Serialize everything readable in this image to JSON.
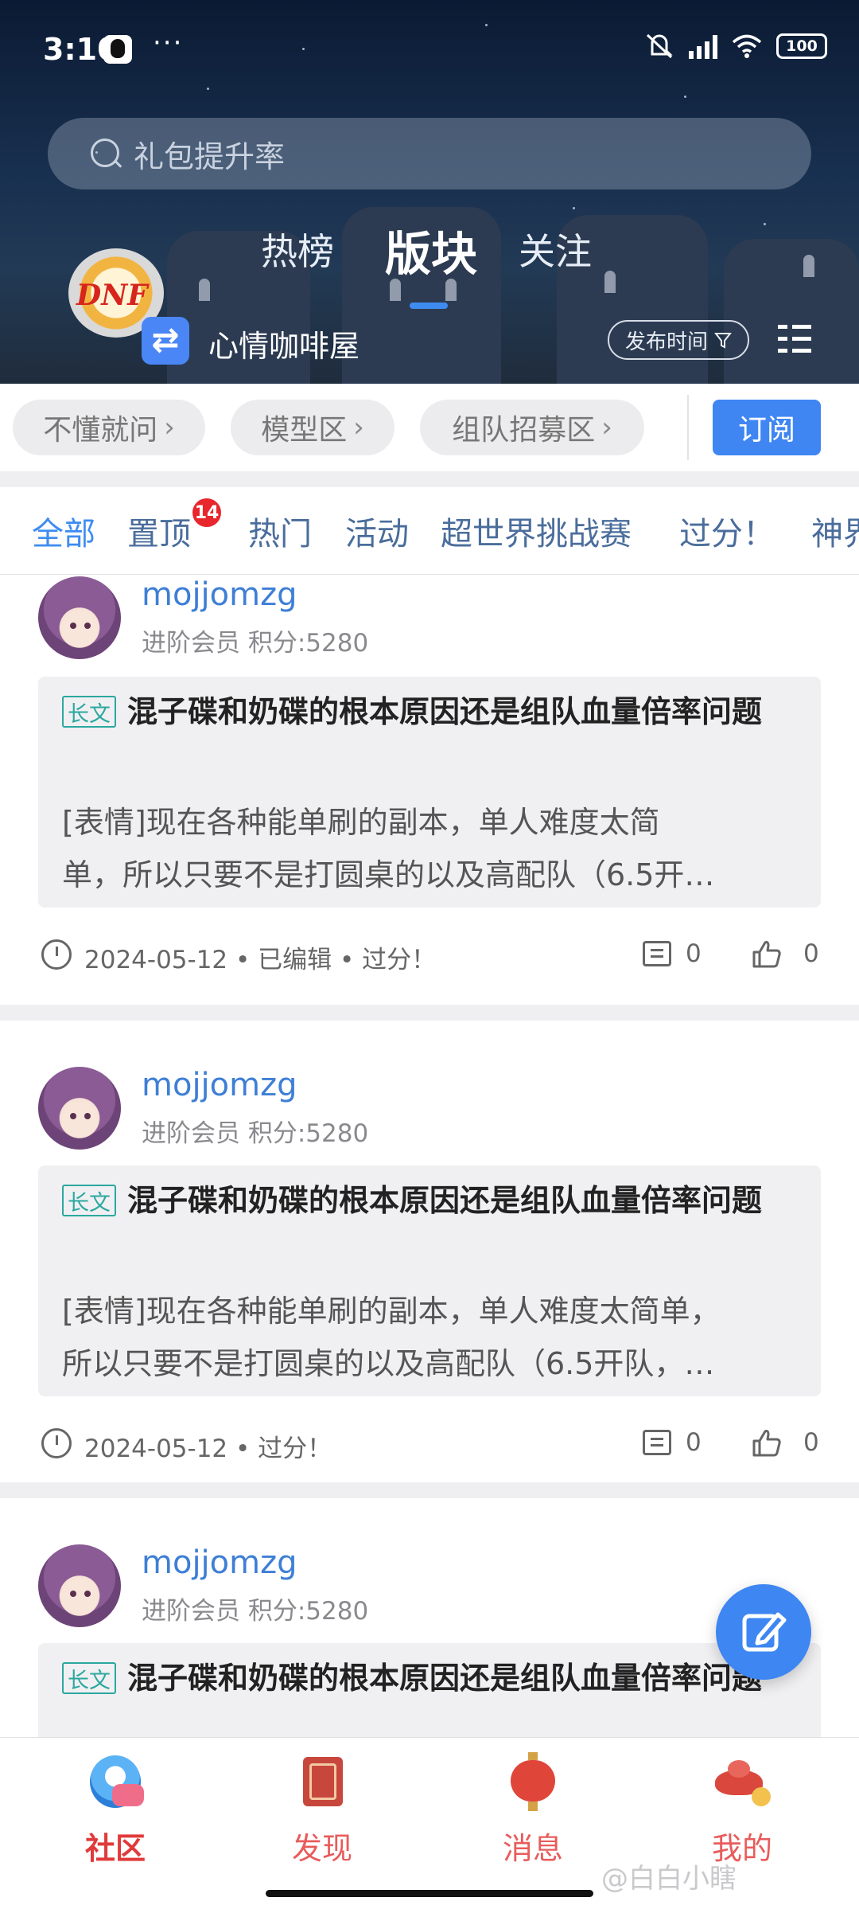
{
  "status_bar": {
    "time": "3:10",
    "more": "···",
    "battery": "100"
  },
  "search": {
    "placeholder": "礼包提升率"
  },
  "top_tabs": [
    "热榜",
    "版块",
    "关注"
  ],
  "board": {
    "name": "心情咖啡屋",
    "logo_text": "DNF",
    "sort_label": "发布时间"
  },
  "quick_links": [
    "不懂就问",
    "模型区",
    "组队招募区"
  ],
  "subscribe_label": "订阅",
  "categories": [
    "全部",
    "置顶",
    "热门",
    "活动",
    "超世界挑战赛",
    "过分！",
    "神界"
  ],
  "pinned_badge": "14",
  "posts": [
    {
      "username": "mojjomzg",
      "meta": "进阶会员  积分:5280",
      "tag": "长文",
      "title": "混子碟和奶碟的根本原因还是组队血量倍率问题",
      "excerpt_line1": " [表情]现在各种能单刷的副本，单人难度太简",
      "excerpt_line2": "单，所以只要不是打圆桌的以及高配队（6.5开…",
      "footer": "2024-05-12  •  已编辑  •  过分！",
      "comments": "0",
      "likes": "0"
    },
    {
      "username": "mojjomzg",
      "meta": "进阶会员  积分:5280",
      "tag": "长文",
      "title": "混子碟和奶碟的根本原因还是组队血量倍率问题",
      "excerpt_line1": "[表情]现在各种能单刷的副本，单人难度太简单，",
      "excerpt_line2": "所以只要不是打圆桌的以及高配队（6.5开队，…",
      "footer": "2024-05-12  •  过分！",
      "comments": "0",
      "likes": "0"
    },
    {
      "username": "mojjomzg",
      "meta": "进阶会员  积分:5280",
      "tag": "长文",
      "title": "混子碟和奶碟的根本原因还是组队血量倍率问题",
      "excerpt_line1": "",
      "excerpt_line2": "",
      "footer": "",
      "comments": "",
      "likes": ""
    }
  ],
  "bottom_nav": [
    "社区",
    "发现",
    "消息",
    "我的"
  ],
  "watermark": "@白白小瞎",
  "colors": {
    "accent": "#3e8cf0",
    "nav_active": "#e03a3a",
    "tag": "#2ba8a0"
  }
}
